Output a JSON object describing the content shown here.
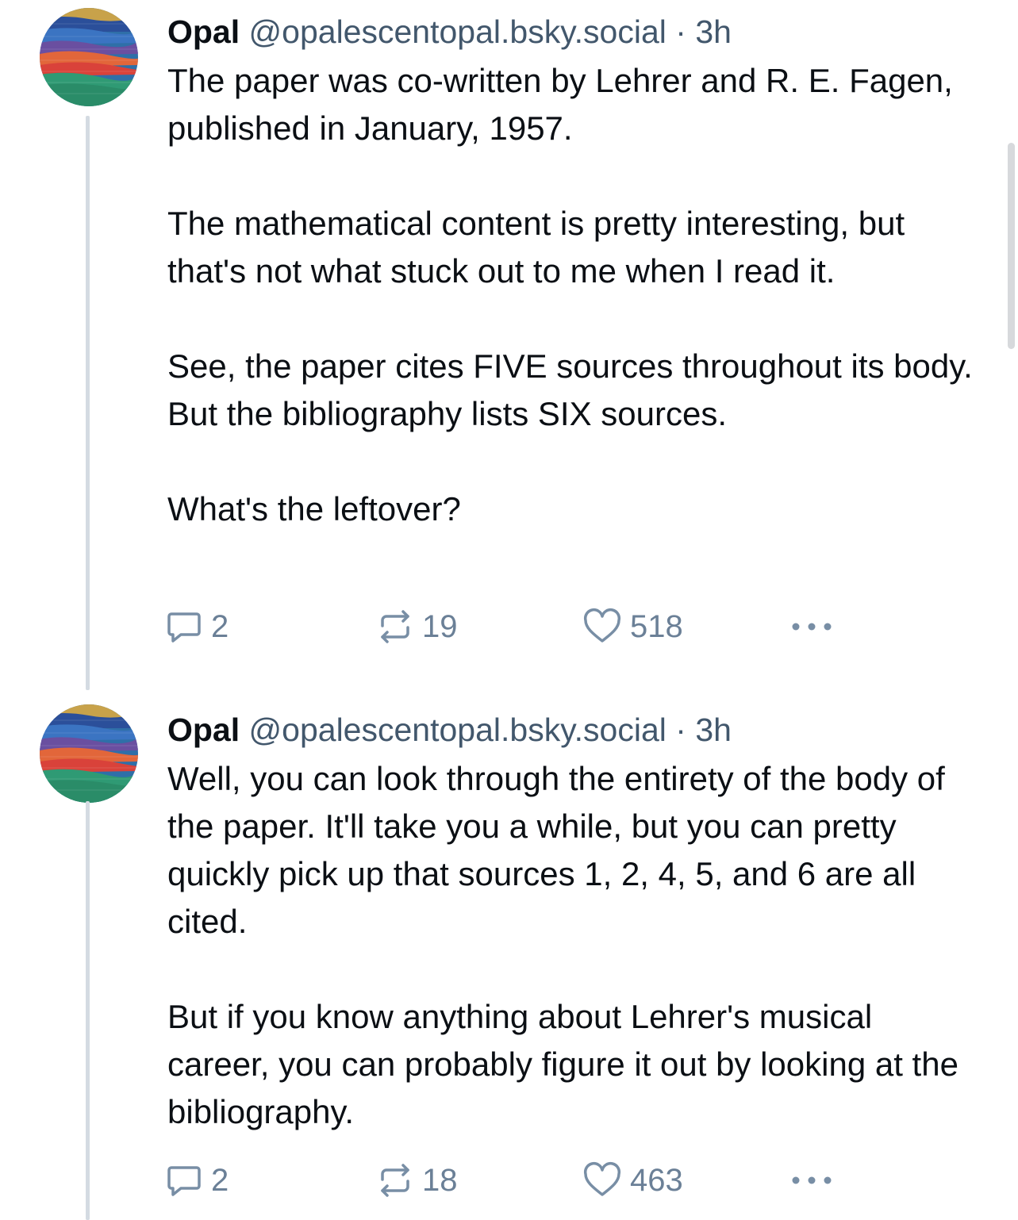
{
  "posts": [
    {
      "author": {
        "name": "Opal",
        "handle": "@opalescentopal.bsky.social"
      },
      "separator": "·",
      "time": "3h",
      "paragraphs": [
        "The paper was co-written by Lehrer and R. E. Fagen, published in January, 1957.",
        "The mathematical content is pretty interesting, but that's not what stuck out to me when I read it.",
        "See, the paper cites FIVE sources throughout its body. But the bibliography lists SIX sources.",
        "What's the leftover?"
      ],
      "stats": {
        "replies": "2",
        "reposts": "19",
        "likes": "518"
      }
    },
    {
      "author": {
        "name": "Opal",
        "handle": "@opalescentopal.bsky.social"
      },
      "separator": "·",
      "time": "3h",
      "paragraphs": [
        "Well, you can look through the entirety of the body of the paper. It'll take you a while, but you can pretty quickly pick up that sources 1, 2, 4, 5, and 6 are all cited.",
        "But if you know anything about Lehrer's musical career, you can probably figure it out by looking at the bibliography."
      ],
      "stats": {
        "replies": "2",
        "reposts": "18",
        "likes": "463"
      }
    }
  ],
  "icons": {
    "reply": "speech-bubble-icon",
    "repost": "repost-arrows-icon",
    "like": "heart-outline-icon",
    "more": "ellipsis-horizontal-icon"
  },
  "colors": {
    "text": "#0b0f14",
    "secondary_text": "#42576c",
    "icon": "#788ea5",
    "thread_line": "#d4dbe2",
    "background": "#ffffff"
  }
}
